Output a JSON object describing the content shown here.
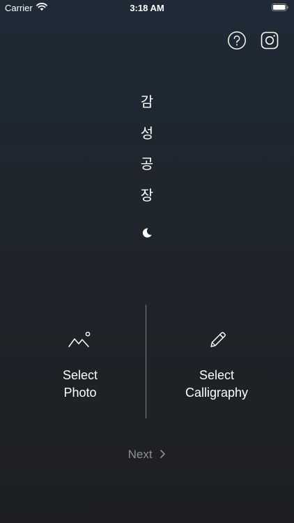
{
  "status_bar": {
    "carrier": "Carrier",
    "time": "3:18 AM"
  },
  "header": {
    "help_icon": "question-circle-icon",
    "instagram_icon": "instagram-icon"
  },
  "title": {
    "chars": [
      "감",
      "성",
      "공",
      "장"
    ],
    "moon_icon": "crescent-moon-icon"
  },
  "actions": {
    "photo": {
      "icon": "mountain-sun-icon",
      "label_line1": "Select",
      "label_line2": "Photo"
    },
    "calligraphy": {
      "icon": "pencil-icon",
      "label_line1": "Select",
      "label_line2": "Calligraphy"
    }
  },
  "footer": {
    "next_label": "Next"
  },
  "colors": {
    "background_top": "#1e2a36",
    "background_bottom": "#1d1f22",
    "text": "#ffffff",
    "next_text": "#8d9096",
    "divider": "#7a7f86"
  }
}
